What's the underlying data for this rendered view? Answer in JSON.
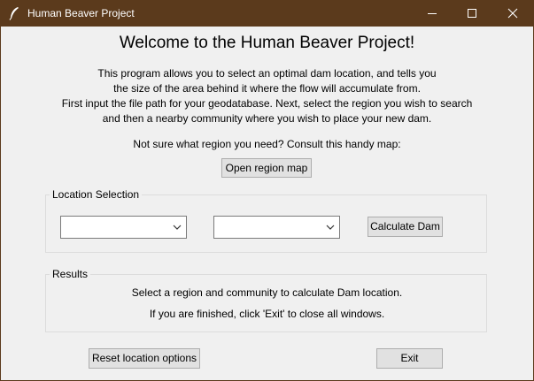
{
  "window": {
    "title": "Human Beaver Project",
    "icon": "feather-icon",
    "controls": [
      "minimize-icon",
      "maximize-icon",
      "close-icon"
    ],
    "titlebar_color": "#5b3a1c"
  },
  "welcome": "Welcome to the Human Beaver Project!",
  "description": [
    "This program allows you to select an optimal dam location, and tells you",
    "the size of the area behind it where the flow will accumulate from.",
    "First input the file path for your geodatabase. Next, select the region you wish to search",
    "and then a nearby community where you wish to place your new dam."
  ],
  "map_prompt": "Not sure what region you need? Consult this handy map:",
  "open_map_button": "Open region map",
  "location": {
    "legend": "Location Selection",
    "region_value": "",
    "community_value": "",
    "calculate_button": "Calculate Dam"
  },
  "results": {
    "legend": "Results",
    "line1": "Select a region and community to calculate Dam location.",
    "line2": "If you are finished, click 'Exit' to close all windows."
  },
  "reset_button": "Reset location options",
  "exit_button": "Exit"
}
